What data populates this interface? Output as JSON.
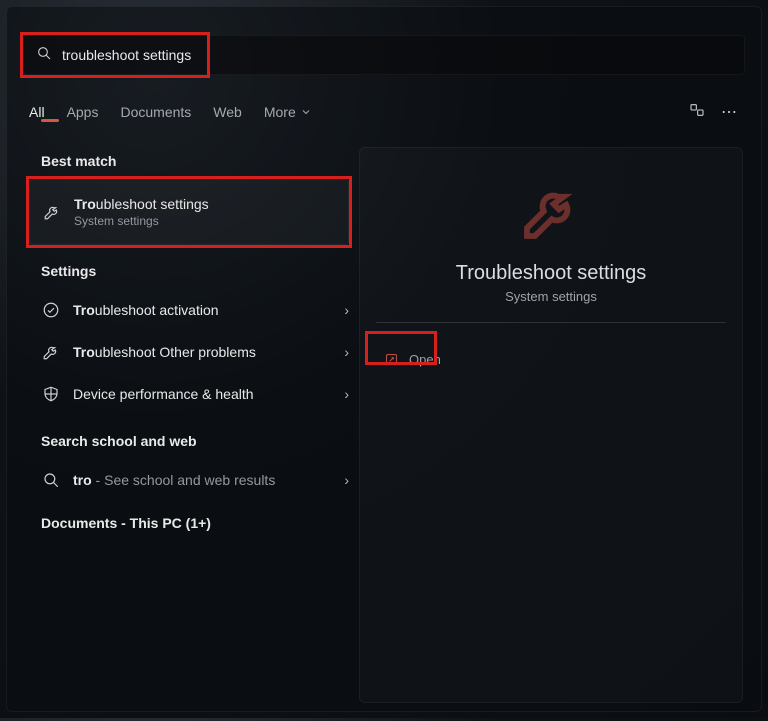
{
  "search": {
    "value": "troubleshoot settings"
  },
  "tabs": {
    "items": [
      "All",
      "Apps",
      "Documents",
      "Web",
      "More"
    ],
    "active_index": 0
  },
  "best_match": {
    "header": "Best match",
    "title_prefix": "Tro",
    "title_rest": "ubleshoot settings",
    "subtitle": "System settings"
  },
  "settings_section": {
    "header": "Settings",
    "items": [
      {
        "prefix": "Tro",
        "rest": "ubleshoot activation",
        "icon": "check-circle"
      },
      {
        "prefix": "Tro",
        "rest": "ubleshoot Other problems",
        "icon": "wrench"
      },
      {
        "prefix": "",
        "rest": "Device performance & health",
        "icon": "shield"
      }
    ]
  },
  "web_section": {
    "header": "Search school and web",
    "item": {
      "prefix": "tro",
      "rest": " - See school and web results",
      "icon": "search"
    }
  },
  "documents_header": "Documents - This PC (1+)",
  "preview": {
    "title": "Troubleshoot settings",
    "subtitle": "System settings",
    "actions": [
      {
        "label": "Open"
      }
    ]
  }
}
